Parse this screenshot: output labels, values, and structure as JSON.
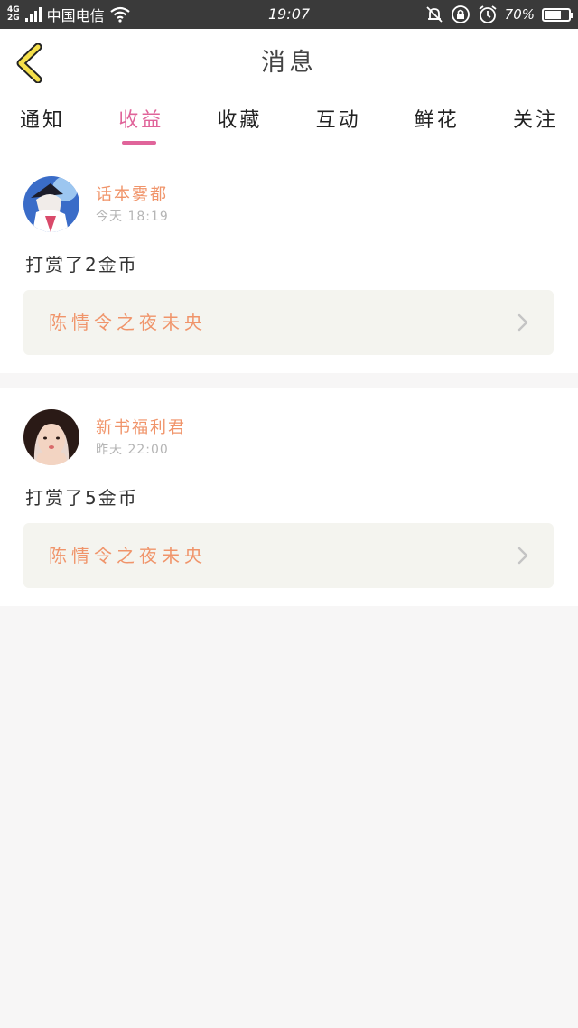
{
  "status_bar": {
    "network_top": "4G",
    "network_bottom": "2G",
    "carrier": "中国电信",
    "time": "19:07",
    "battery_percent": "70%",
    "battery_level": 0.7,
    "icons": [
      "signal-icon",
      "wifi-icon",
      "bell-muted-icon",
      "rotation-lock-icon",
      "alarm-icon",
      "battery-icon"
    ]
  },
  "header": {
    "title": "消息",
    "back_icon": "chevron-left-icon",
    "back_color": "#f5e04a"
  },
  "tabs": [
    {
      "label": "通知",
      "active": false
    },
    {
      "label": "收益",
      "active": true
    },
    {
      "label": "收藏",
      "active": false
    },
    {
      "label": "互动",
      "active": false
    },
    {
      "label": "鲜花",
      "active": false
    },
    {
      "label": "关注",
      "active": false
    }
  ],
  "accent_color": "#e0649a",
  "name_color": "#f0946a",
  "messages": [
    {
      "username": "话本雾都",
      "time": "今天  18:19",
      "text": "打赏了2金币",
      "book_title": "陈情令之夜未央"
    },
    {
      "username": "新书福利君",
      "time": "昨天  22:00",
      "text": "打赏了5金币",
      "book_title": "陈情令之夜未央"
    }
  ]
}
